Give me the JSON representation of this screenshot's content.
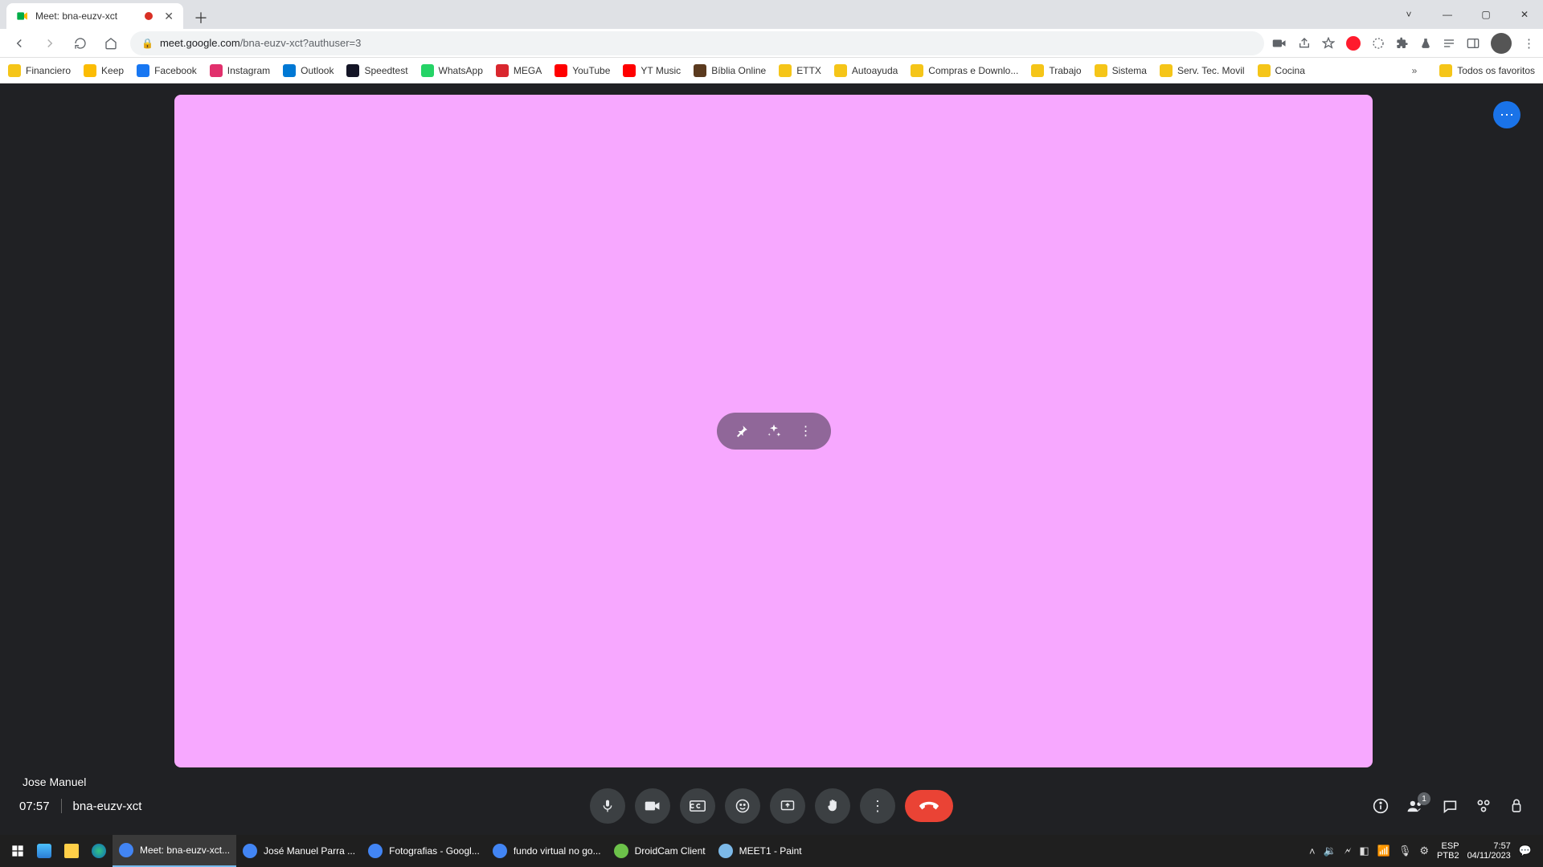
{
  "browser": {
    "tab_title": "Meet: bna-euzv-xct",
    "url_host": "meet.google.com",
    "url_path": "/bna-euzv-xct?authuser=3",
    "bookmarks": [
      {
        "label": "Financiero",
        "color": "#f5c518"
      },
      {
        "label": "Keep",
        "color": "#fbbc04"
      },
      {
        "label": "Facebook",
        "color": "#1877f2"
      },
      {
        "label": "Instagram",
        "color": "#e1306c"
      },
      {
        "label": "Outlook",
        "color": "#0078d4"
      },
      {
        "label": "Speedtest",
        "color": "#141526"
      },
      {
        "label": "WhatsApp",
        "color": "#25d366"
      },
      {
        "label": "MEGA",
        "color": "#d9272e"
      },
      {
        "label": "YouTube",
        "color": "#ff0000"
      },
      {
        "label": "YT Music",
        "color": "#ff0000"
      },
      {
        "label": "Bíblia Online",
        "color": "#5b3a1e"
      },
      {
        "label": "ETTX",
        "color": "#f5c518"
      },
      {
        "label": "Autoayuda",
        "color": "#f5c518"
      },
      {
        "label": "Compras e Downlo...",
        "color": "#f5c518"
      },
      {
        "label": "Trabajo",
        "color": "#f5c518"
      },
      {
        "label": "Sistema",
        "color": "#f5c518"
      },
      {
        "label": "Serv. Tec. Movil",
        "color": "#f5c518"
      },
      {
        "label": "Cocina",
        "color": "#f5c518"
      }
    ],
    "all_bookmarks_label": "Todos os favoritos"
  },
  "meet": {
    "self_name": "Jose Manuel",
    "clock": "07:57",
    "room_code": "bna-euzv-xct",
    "participants_count": "1"
  },
  "taskbar": {
    "items": [
      {
        "label": "Meet: bna-euzv-xct...",
        "icon": "#4285f4",
        "active": true
      },
      {
        "label": "José Manuel Parra ...",
        "icon": "#4285f4",
        "active": false
      },
      {
        "label": "Fotografias - Googl...",
        "icon": "#4285f4",
        "active": false
      },
      {
        "label": "fundo virtual no go...",
        "icon": "#4285f4",
        "active": false
      },
      {
        "label": "DroidCam Client",
        "icon": "#6cc24a",
        "active": false
      },
      {
        "label": "MEET1 - Paint",
        "icon": "#7cb9e8",
        "active": false
      }
    ],
    "lang": "ESP",
    "kb": "PTB2",
    "time": "7:57",
    "date": "04/11/2023"
  }
}
